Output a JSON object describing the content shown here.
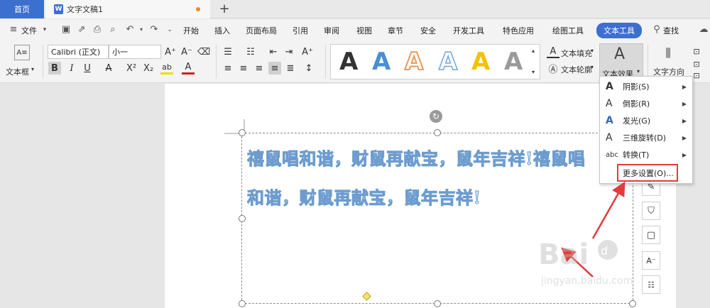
{
  "tabs": {
    "home_label": "首页",
    "doc_icon": "W",
    "doc_label": "文字文稿1",
    "new_tab": "+"
  },
  "menu": {
    "file_label": "文件",
    "items": [
      "开始",
      "插入",
      "页面布局",
      "引用",
      "审阅",
      "视图",
      "章节",
      "安全",
      "开发工具",
      "特色应用",
      "绘图工具"
    ],
    "active_label": "文本工具",
    "search_label": "查找"
  },
  "ribbon": {
    "textbox_label": "文本框",
    "font_name": "Calibri (正文)",
    "font_size": "小一",
    "bold": "B",
    "italic": "I",
    "underline": "U",
    "fill_label": "文本填充",
    "outline_label": "文本轮廓",
    "effect_label": "文本效果",
    "direction_label": "文字方向",
    "gallery": [
      {
        "letter": "A",
        "color": "#111111",
        "style": "solid"
      },
      {
        "letter": "A",
        "color": "#4a8fd4",
        "style": "solid"
      },
      {
        "letter": "A",
        "color": "#e89a5a",
        "style": "outline"
      },
      {
        "letter": "A",
        "color": "#6fa6dc",
        "style": "outline"
      },
      {
        "letter": "A",
        "color": "#f2c200",
        "style": "solid"
      },
      {
        "letter": "A",
        "color": "#9a9a9a",
        "style": "gradient"
      }
    ]
  },
  "document": {
    "text": "禧鼠唱和谐，财鼠再献宝，鼠年吉祥!禧鼠唱和谐，财鼠再献宝，鼠年吉祥!"
  },
  "effects_menu": {
    "items": [
      {
        "icon": "A",
        "label": "阴影(S)"
      },
      {
        "icon": "A",
        "label": "倒影(R)"
      },
      {
        "icon": "A",
        "label": "发光(G)"
      },
      {
        "icon": "A",
        "label": "三维旋转(D)"
      },
      {
        "icon": "abc",
        "label": "转换(T)"
      }
    ],
    "more_label": "更多设置(O)..."
  },
  "watermark": {
    "brand": "Bai du 经验",
    "site": "jingyan.baidu.com"
  },
  "colors": {
    "accent": "#3d6fd0",
    "highlight_box": "#e23b3b",
    "arrow": "#e23b3b"
  }
}
